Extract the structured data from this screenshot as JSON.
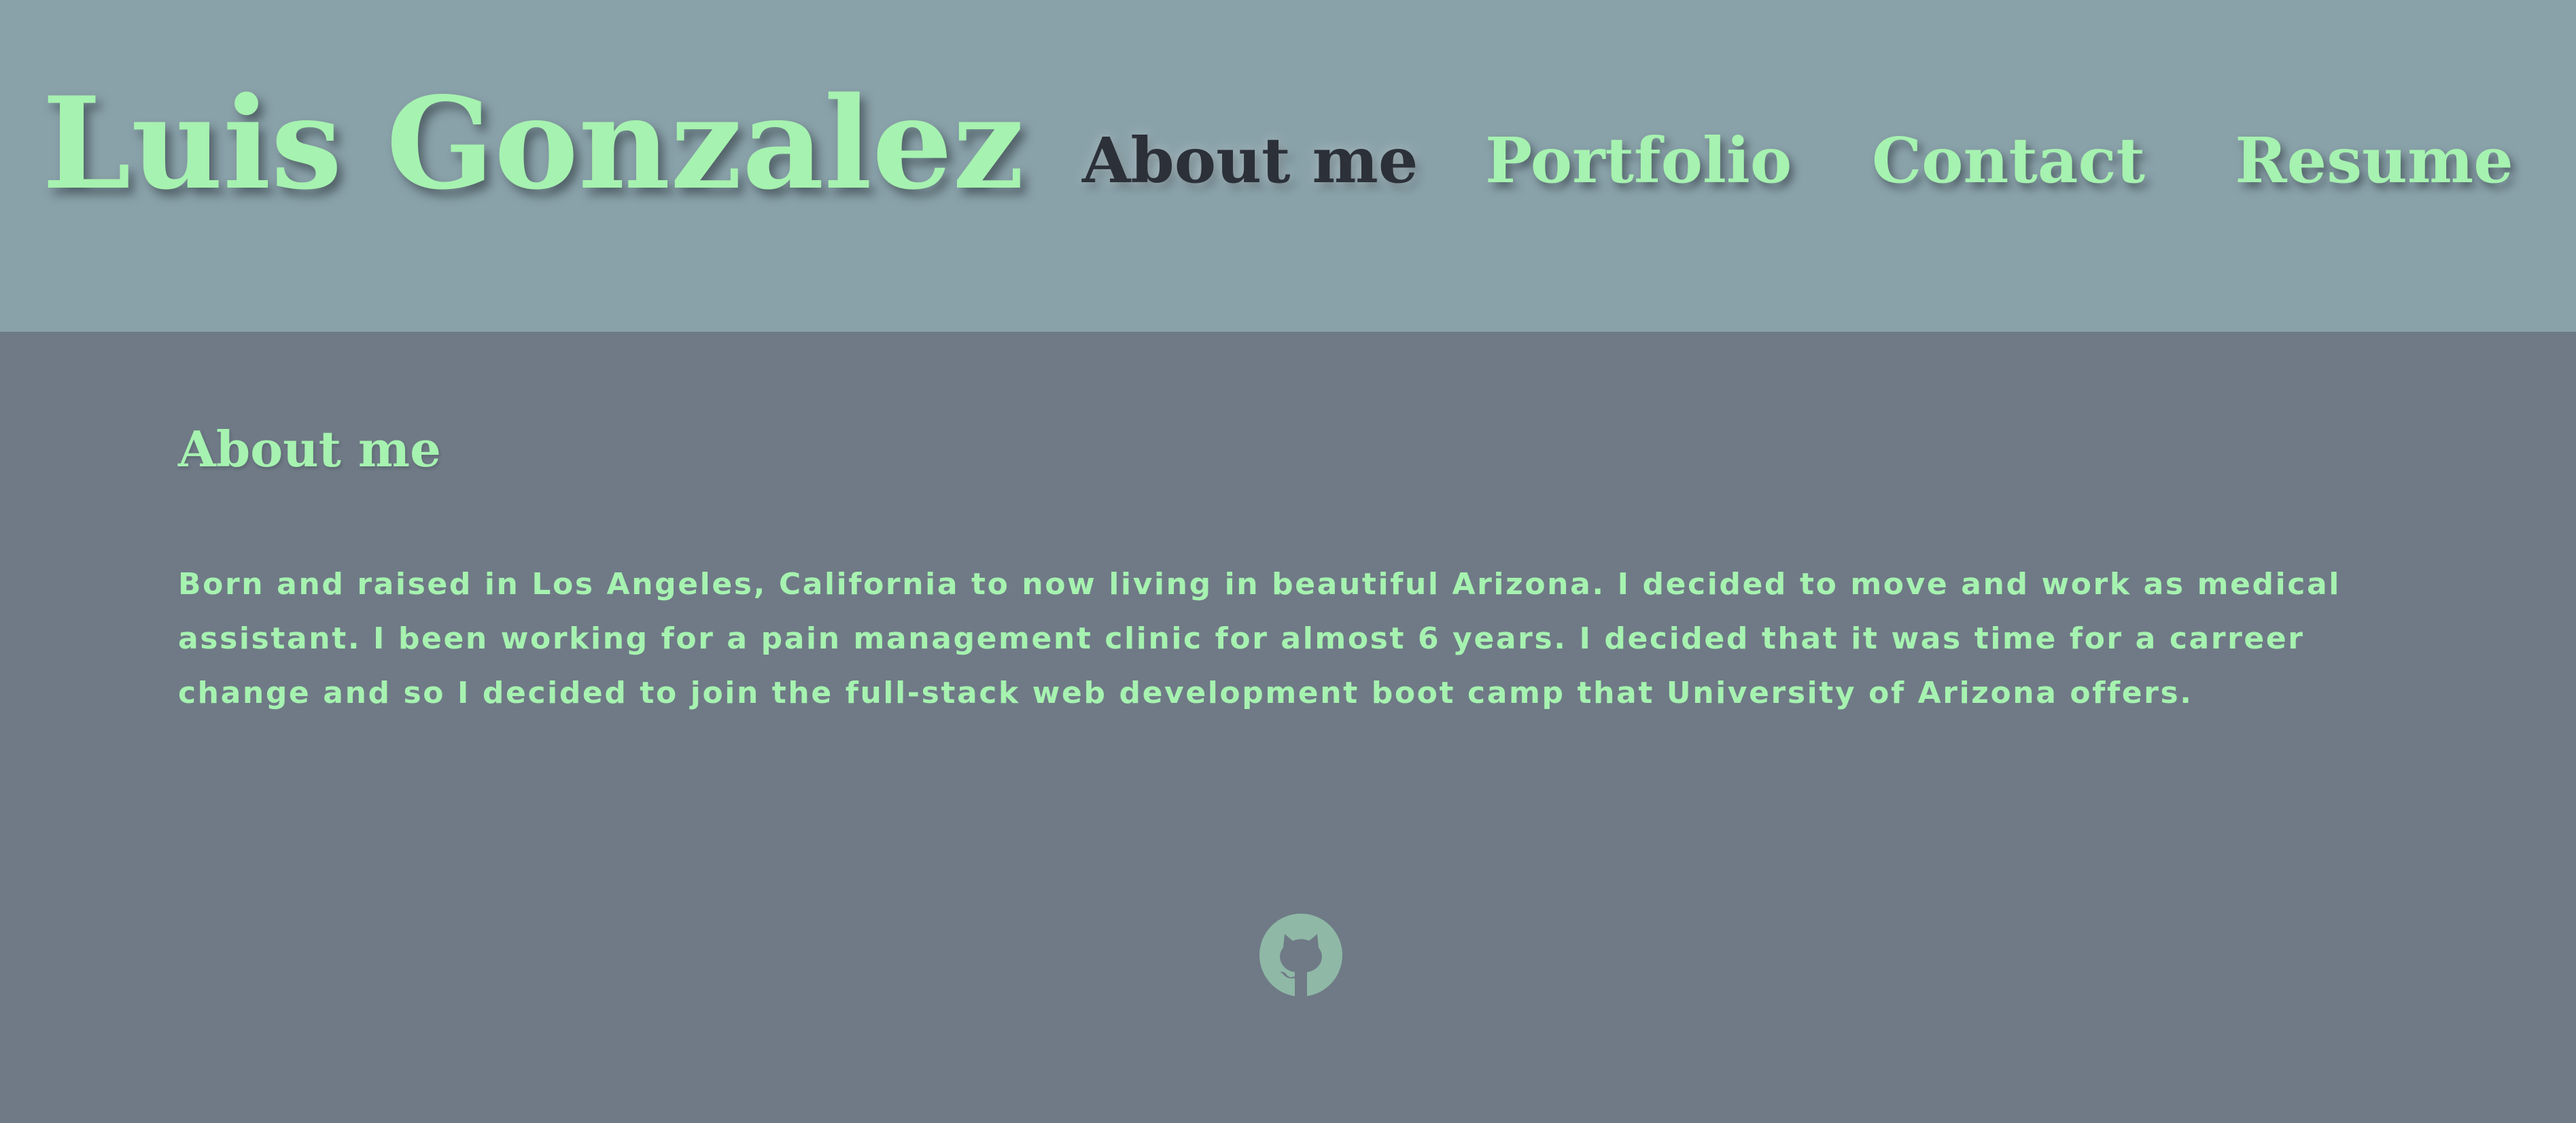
{
  "header": {
    "site_title": "Luis Gonzalez",
    "nav": [
      {
        "label": "About me",
        "active": true
      },
      {
        "label": "Portfolio",
        "active": false
      },
      {
        "label": "Contact",
        "active": false
      },
      {
        "label": "Resume",
        "active": false
      }
    ]
  },
  "main": {
    "section_title": "About me",
    "paragraph": "Born and raised in Los Angeles, California to now living in beautiful Arizona. I decided to move and work as medical assistant. I been working for a pain management clinic for almost 6 years. I decided that it was time for a carreer change and so I decided to join the full-stack web development boot camp that University of Arizona offers."
  },
  "footer": {
    "icons": [
      "github-icon"
    ]
  },
  "colors": {
    "header_background": "#89a1a9",
    "page_background": "#6f7a86",
    "accent_green": "#a6f2b0",
    "active_nav_text": "#2c3038",
    "icon_fill": "#8fb8a6"
  }
}
